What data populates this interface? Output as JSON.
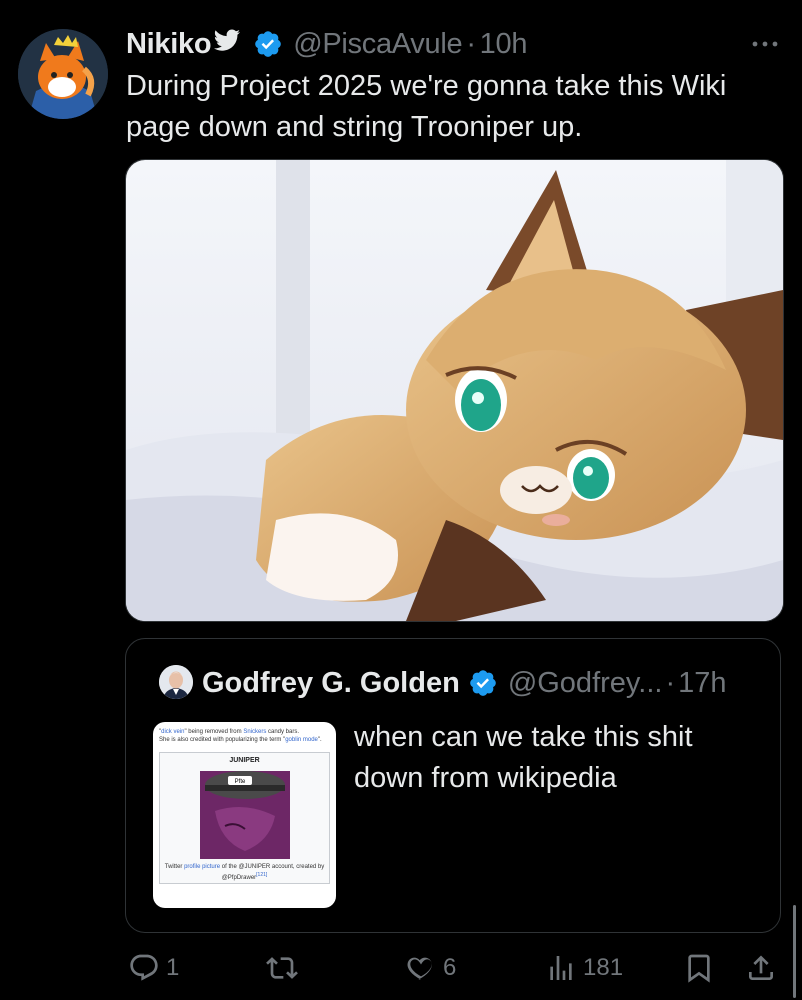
{
  "tweet": {
    "display_name": "Nikiko",
    "handle": "@PiscaAvule",
    "time": "10h",
    "separator": "·",
    "text": "During Project 2025 we're gonna take this Wiki page down and string Trooniper up."
  },
  "quote": {
    "display_name": "Godfrey G. Golden",
    "handle": "@Godfrey...",
    "time": "17h",
    "separator": "·",
    "text": "when can we take this shit down from wikipedia",
    "thumb": {
      "line1_link": "dick vein",
      "line1_rest": "\" being removed from ",
      "line1_link2": "Snickers",
      "line1_end": " candy bars.",
      "line2": "She is also credited with popularizing the term \"",
      "line2_link": "goblin mode",
      "line2_end": "\".",
      "header": "JUNIPER",
      "caption_pre": "Twitter ",
      "caption_link": "profile picture",
      "caption_post": " of the @JUNIPER account, created by @PfpDrawer",
      "caption_ref": "[121]",
      "hat_text": "Pfte"
    }
  },
  "actions": {
    "replies": "1",
    "reposts": "",
    "likes": "6",
    "views": "181"
  },
  "colors": {
    "background": "#000000",
    "text": "#e7e9ea",
    "muted": "#71767b",
    "verified": "#1d9bf0",
    "border": "#2f3336"
  }
}
